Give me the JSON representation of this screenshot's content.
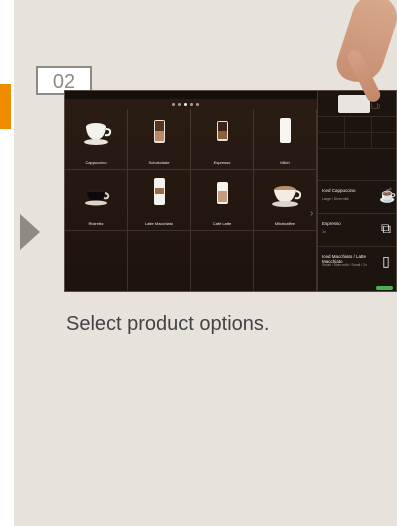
{
  "step": {
    "number": "02"
  },
  "caption": {
    "text": "Select product options."
  },
  "screen": {
    "pager_dots": 5,
    "products": [
      {
        "label": "Cappuccino",
        "icon": "cappuccino-icon"
      },
      {
        "label": "Schokolade",
        "icon": "chocolate-drink-icon"
      },
      {
        "label": "Espresso",
        "icon": "espresso-icon"
      },
      {
        "label": "Milch",
        "icon": "milk-glass-icon"
      },
      {
        "label": "Ristretto",
        "icon": "ristretto-icon"
      },
      {
        "label": "Latte Macchiato",
        "icon": "latte-macchiato-icon"
      },
      {
        "label": "Café Latte",
        "icon": "cafe-latte-icon"
      },
      {
        "label": "Milchkaffee",
        "icon": "milchkaffee-icon"
      },
      {
        "label": "",
        "icon": ""
      },
      {
        "label": "",
        "icon": ""
      },
      {
        "label": "",
        "icon": ""
      },
      {
        "label": "",
        "icon": ""
      }
    ],
    "options": [
      {
        "title": "Iced Cappuccino",
        "subtitle": "Large / Skim milk",
        "icon": "cup-icon"
      },
      {
        "title": "Espresso",
        "subtitle": "2x",
        "icon": "double-cup-icon"
      },
      {
        "title": "Iced Macchiato / Latte Macchiato",
        "subtitle": "Small / Skim milk / Small / 2x",
        "icon": "glass-icon"
      }
    ]
  },
  "colors": {
    "accent": "#f08c00",
    "card_bg": "#e7e2dc",
    "badge_border": "#8f8a83",
    "screen_bg": "#241811",
    "text_dark": "#434343",
    "success": "#49b24f"
  }
}
